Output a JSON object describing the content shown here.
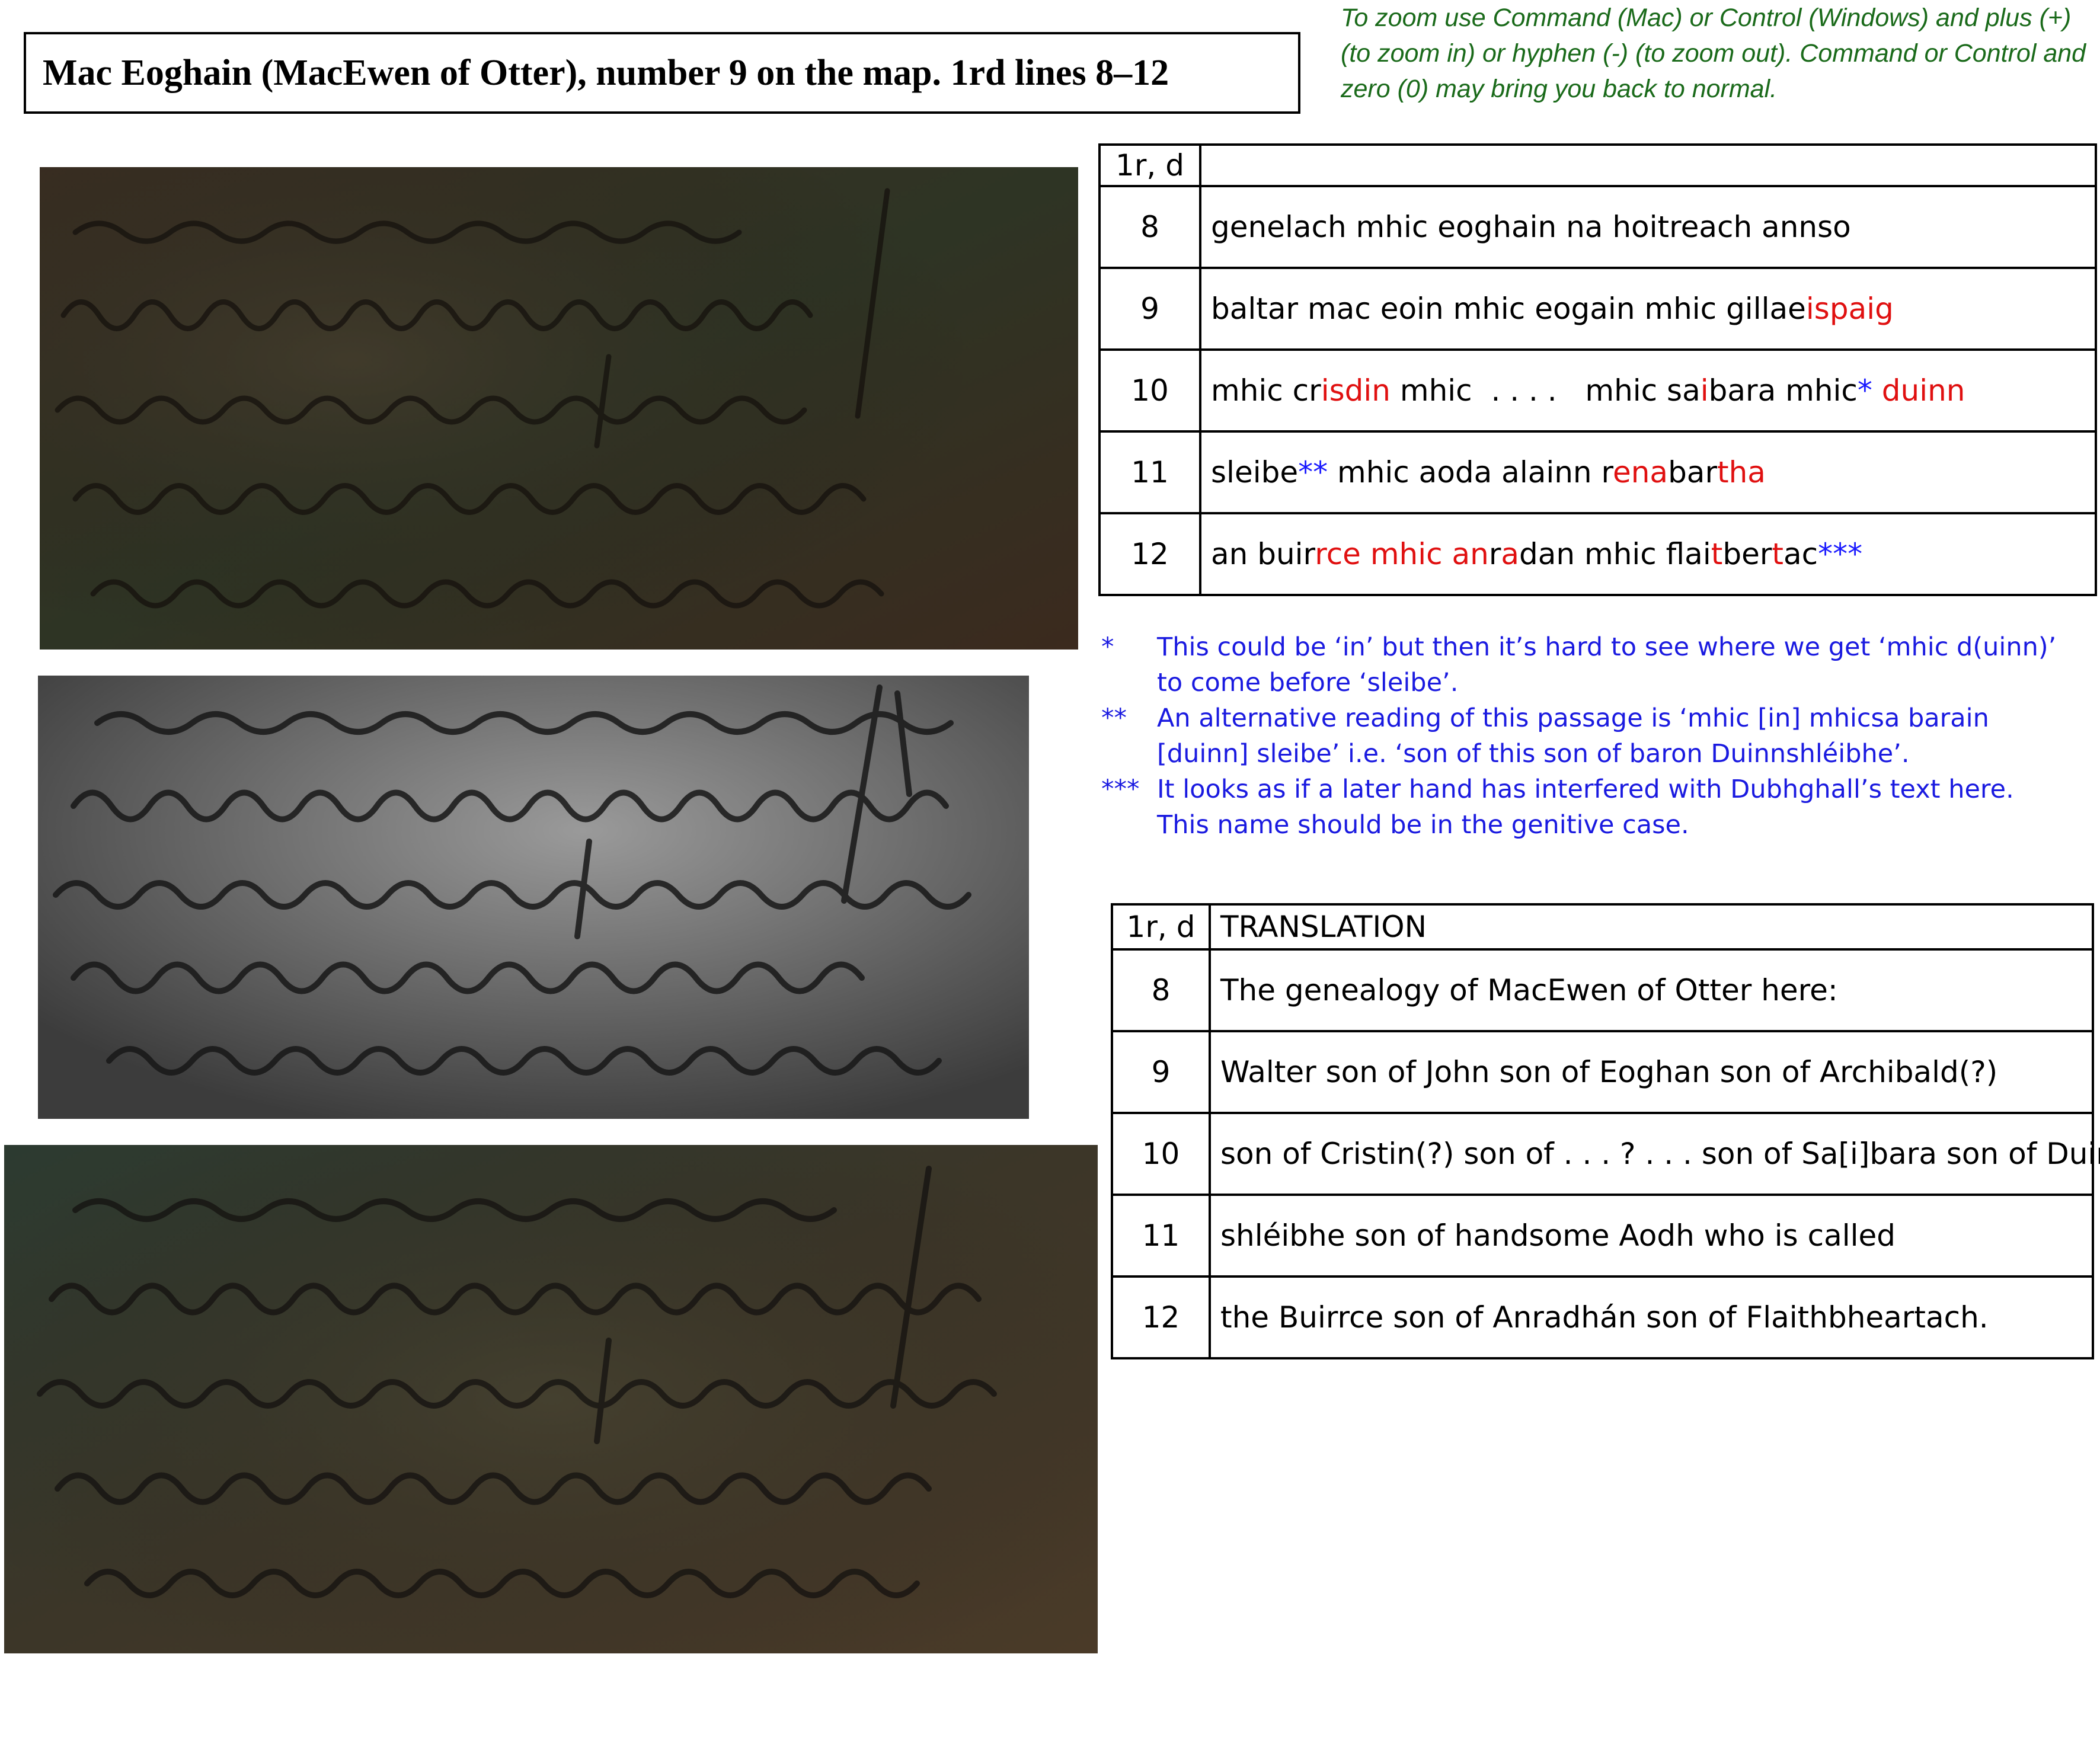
{
  "header": {
    "title": "Mac Eoghain (MacEwen of Otter), number 9 on the map. 1rd lines 8–12",
    "zoom_instructions": [
      "To zoom use Command (Mac) or Control (Windows) and plus (+)",
      "(to zoom in) or hyphen (-) (to zoom out).  Command or Control and",
      "zero (0) may bring you back to normal."
    ]
  },
  "images": [
    {
      "name": "manuscript-colour-image",
      "tone": "colour"
    },
    {
      "name": "manuscript-greyscale-image",
      "tone": "greyscale"
    },
    {
      "name": "manuscript-enhanced-image",
      "tone": "colour"
    }
  ],
  "transcription": {
    "header_ref": "1r, d",
    "header_text": "",
    "rows": [
      {
        "num": "8",
        "segments": [
          {
            "t": "genelach mhic eoghain na hoitreach annso",
            "c": "black"
          }
        ]
      },
      {
        "num": "9",
        "segments": [
          {
            "t": "baltar mac eoin mhic eogain mhic gillae",
            "c": "black"
          },
          {
            "t": "ispaig",
            "c": "red"
          }
        ]
      },
      {
        "num": "10",
        "segments": [
          {
            "t": "mhic cr",
            "c": "black"
          },
          {
            "t": "isdin",
            "c": "red"
          },
          {
            "t": " mhic  . . . .   mhic sa",
            "c": "black"
          },
          {
            "t": "i",
            "c": "red"
          },
          {
            "t": "bara mhic",
            "c": "black"
          },
          {
            "t": "*",
            "c": "blue"
          },
          {
            "t": " duinn",
            "c": "red"
          }
        ]
      },
      {
        "num": "11",
        "segments": [
          {
            "t": "sleibe",
            "c": "black"
          },
          {
            "t": "**",
            "c": "blue"
          },
          {
            "t": " mhic aoda alainn r",
            "c": "black"
          },
          {
            "t": "ena",
            "c": "red"
          },
          {
            "t": "bar",
            "c": "black"
          },
          {
            "t": "tha",
            "c": "red"
          }
        ]
      },
      {
        "num": "12",
        "segments": [
          {
            "t": "an buir",
            "c": "black"
          },
          {
            "t": "rce mhic an",
            "c": "red"
          },
          {
            "t": "r",
            "c": "black"
          },
          {
            "t": "a",
            "c": "red"
          },
          {
            "t": "dan mhic flai",
            "c": "black"
          },
          {
            "t": "t",
            "c": "red"
          },
          {
            "t": "ber",
            "c": "black"
          },
          {
            "t": "t",
            "c": "red"
          },
          {
            "t": "ac",
            "c": "black"
          },
          {
            "t": "***",
            "c": "blue"
          }
        ]
      }
    ]
  },
  "notes": [
    {
      "mark": "*",
      "text": "This could be ‘in’ but then it’s hard to see where we get ‘mhic d(uinn)’ to come before ‘sleibe’."
    },
    {
      "mark": "**",
      "text": "An alternative reading of this passage is ‘mhic [in] mhicsa barain [duinn] sleibe’ i.e. ‘son of this son of baron Duinnshléibhe’."
    },
    {
      "mark": "***",
      "text": "It looks as if a later hand has interfered with Dubhghall’s text here. This name should be in the genitive case."
    }
  ],
  "translation": {
    "header_ref": "1r, d",
    "header_text": "TRANSLATION",
    "rows": [
      {
        "num": "8",
        "text": "The genealogy of MacEwen of Otter here:"
      },
      {
        "num": "9",
        "text": "Walter son of John son of Eoghan son of Archibald(?)"
      },
      {
        "num": "10",
        "text": "son of Cristin(?) son of . . . ? . . . son of Sa[i]bara son of Duinn"
      },
      {
        "num": "11",
        "text": "shléibhe son of handsome Aodh who is called"
      },
      {
        "num": "12",
        "text": "the Buirrce son of Anradhán son of Flaithbheartach."
      }
    ]
  },
  "colors": {
    "red_highlight": "#e01010",
    "blue_marks": "#1a1aff",
    "notes_text": "#1a1ae0",
    "zoom_note_text": "#1a6a1a"
  }
}
